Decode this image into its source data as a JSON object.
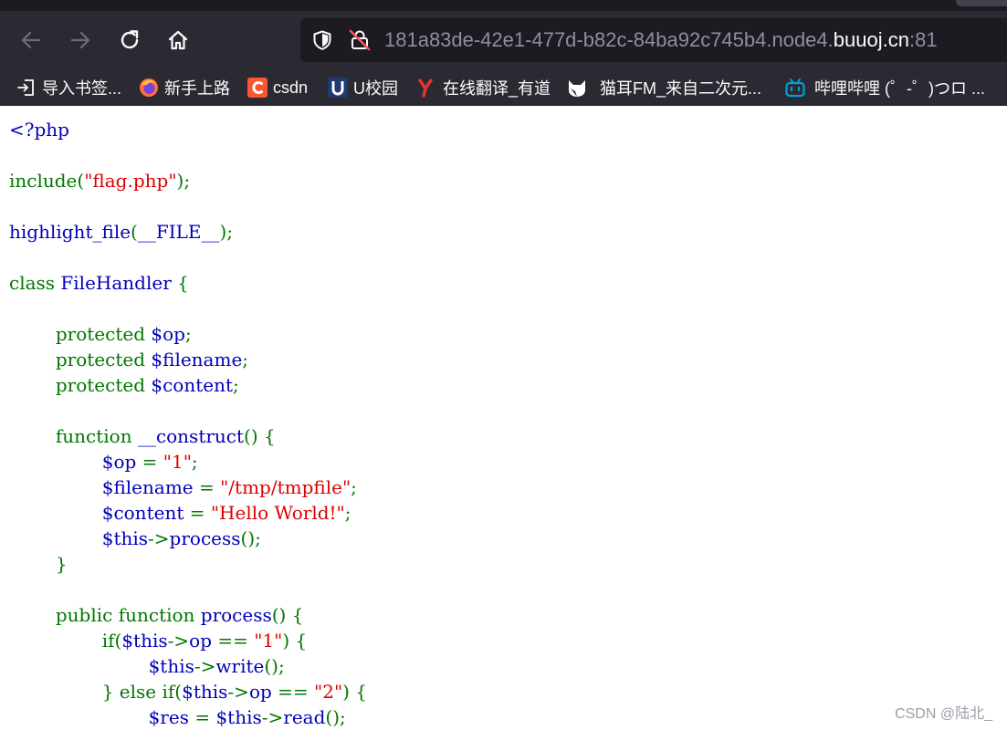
{
  "browser": {
    "url_prefix": "181a83de-42e1-477d-b82c-84ba92c745b4.node4.",
    "url_domain": "buuoj.cn",
    "url_port": ":81",
    "icons": {
      "back": "arrow-left-icon",
      "forward": "arrow-right-icon",
      "reload": "reload-icon",
      "home": "home-icon",
      "tracking": "shield-icon",
      "insecure": "insecure-lock-icon"
    }
  },
  "bookmarks": [
    {
      "label": "导入书签...",
      "icon": "import-icon"
    },
    {
      "label": "新手上路",
      "icon": "firefox-icon"
    },
    {
      "label": "csdn",
      "icon": "csdn-icon"
    },
    {
      "label": "U校园",
      "icon": "u-campus-icon"
    },
    {
      "label": "在线翻译_有道",
      "icon": "youdao-icon"
    },
    {
      "label": "猫耳FM_来自二次元...",
      "icon": "missevan-icon"
    },
    {
      "label": "哔哩哔哩 (゜-゜)つロ ...",
      "icon": "bilibili-icon"
    }
  ],
  "code": {
    "l01": {
      "a": "<?php"
    },
    "l03": {
      "a": "include(",
      "b": "\"flag.php\"",
      "c": ");"
    },
    "l05": {
      "a": "highlight_file",
      "b": "(",
      "c": "__FILE__",
      "d": ");"
    },
    "l07": {
      "a": "class ",
      "b": "FileHandler ",
      "c": "{"
    },
    "l09": {
      "a": "        protected ",
      "b": "$op",
      "c": ";"
    },
    "l10": {
      "a": "        protected ",
      "b": "$filename",
      "c": ";"
    },
    "l11": {
      "a": "        protected ",
      "b": "$content",
      "c": ";"
    },
    "l13": {
      "a": "        function ",
      "b": "__construct",
      "c": "() {"
    },
    "l14": {
      "a": "                ",
      "b": "$op ",
      "c": "= ",
      "d": "\"1\"",
      "e": ";"
    },
    "l15": {
      "a": "                ",
      "b": "$filename ",
      "c": "= ",
      "d": "\"/tmp/tmpfile\"",
      "e": ";"
    },
    "l16": {
      "a": "                ",
      "b": "$content ",
      "c": "= ",
      "d": "\"Hello World!\"",
      "e": ";"
    },
    "l17": {
      "a": "                ",
      "b": "$this",
      "c": "->",
      "d": "process",
      "e": "();"
    },
    "l18": {
      "a": "        }"
    },
    "l20": {
      "a": "        public ",
      "b": "function ",
      "c": "process",
      "d": "() {"
    },
    "l21": {
      "a": "                if(",
      "b": "$this",
      "c": "->",
      "d": "op ",
      "e": "== ",
      "f": "\"1\"",
      "g": ") {"
    },
    "l22": {
      "a": "                        ",
      "b": "$this",
      "c": "->",
      "d": "write",
      "e": "();"
    },
    "l23": {
      "a": "                } else ",
      "b": "if(",
      "c": "$this",
      "d": "->",
      "e": "op ",
      "f": "== ",
      "g": "\"2\"",
      "h": ") {"
    },
    "l24": {
      "a": "                        ",
      "b": "$res ",
      "c": "= ",
      "d": "$this",
      "e": "->",
      "f": "read",
      "g": "();"
    }
  },
  "watermark": "CSDN @陆北_"
}
